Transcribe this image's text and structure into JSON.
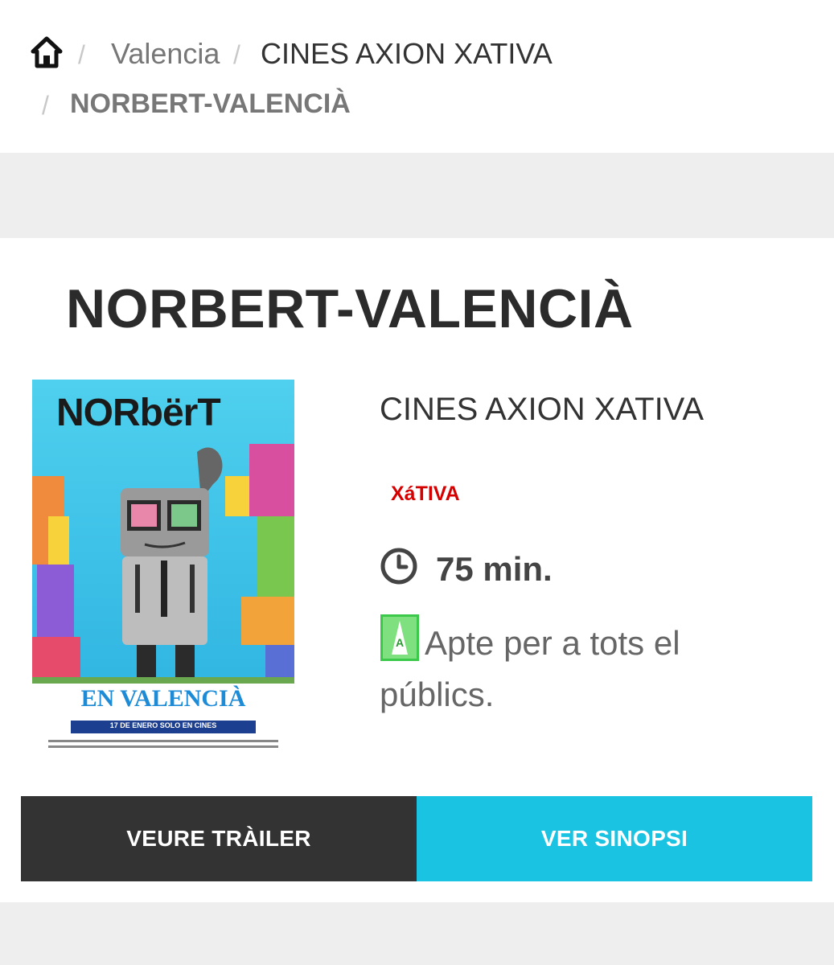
{
  "breadcrumb": {
    "home_icon": "home-icon",
    "separator": "/",
    "city": "Valencia",
    "cinema": "CINES AXION XATIVA",
    "current": "NORBERT-VALENCIÀ"
  },
  "movie": {
    "title": "NORBERT-VALENCIÀ",
    "poster": {
      "title_text": "NORbërT",
      "subtitle": "EN VALENCIÀ",
      "release_line": "17 DE ENERO SOLO EN CINES"
    },
    "cinema_name": "CINES AXION XATIVA",
    "city": "XáTIVA",
    "duration_icon": "clock-icon",
    "duration": "75 min.",
    "rating_icon": "rating-all-ages-icon",
    "rating_text": "Apte per a tots el públics."
  },
  "buttons": {
    "trailer_label": "VEURE TRÀILER",
    "synopsis_label": "VER SINOPSI"
  },
  "colors": {
    "dark_button": "#333333",
    "accent_button": "#1bc3e3",
    "city_red": "#d60000",
    "band_grey": "#eeeeee"
  }
}
